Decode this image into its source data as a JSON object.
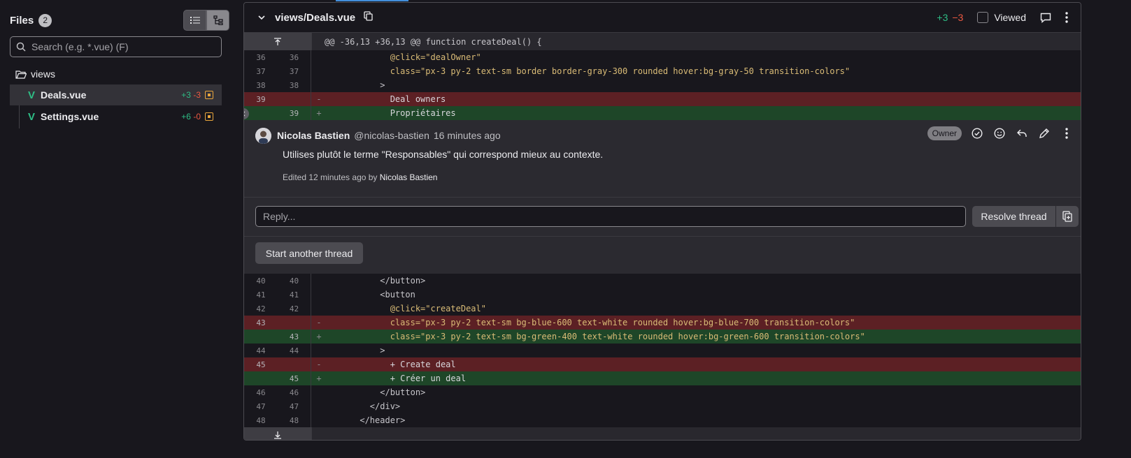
{
  "sidebar": {
    "title": "Files",
    "count": "2",
    "search": {
      "placeholder": "Search (e.g. *.vue) (F)"
    },
    "folder": "views",
    "files": [
      {
        "name": "Deals.vue",
        "added": "+3",
        "removed": "-3"
      },
      {
        "name": "Settings.vue",
        "added": "+6",
        "removed": "-0"
      }
    ]
  },
  "diff": {
    "file_path": "views/Deals.vue",
    "added": "+3",
    "removed": "−3",
    "viewed_label": "Viewed",
    "hunk_header": "@@ -36,13 +36,13 @@ function createDeal() {",
    "lines_top": [
      {
        "old": "36",
        "new": "36",
        "text": "            @click=\"dealOwner\""
      },
      {
        "old": "37",
        "new": "37",
        "text": "            class=\"px-3 py-2 text-sm border border-gray-300 rounded hover:bg-gray-50 transition-colors\""
      },
      {
        "old": "38",
        "new": "38",
        "text": "          >"
      },
      {
        "old": "39",
        "new": "",
        "sign": "-",
        "text": "            Deal owners"
      },
      {
        "old": "",
        "new": "39",
        "sign": "+",
        "text": "            Propriétaires"
      }
    ],
    "lines_bottom": [
      {
        "old": "40",
        "new": "40",
        "text": "          </button>"
      },
      {
        "old": "41",
        "new": "41",
        "text": "          <button"
      },
      {
        "old": "42",
        "new": "42",
        "text": "            @click=\"createDeal\""
      },
      {
        "old": "43",
        "new": "",
        "sign": "-",
        "text": "            class=\"px-3 py-2 text-sm bg-blue-600 text-white rounded hover:bg-blue-700 transition-colors\""
      },
      {
        "old": "",
        "new": "43",
        "sign": "+",
        "text": "            class=\"px-3 py-2 text-sm bg-green-400 text-white rounded hover:bg-green-600 transition-colors\""
      },
      {
        "old": "44",
        "new": "44",
        "text": "          >"
      },
      {
        "old": "45",
        "new": "",
        "sign": "-",
        "text": "            + Create deal"
      },
      {
        "old": "",
        "new": "45",
        "sign": "+",
        "text": "            + Créer un deal"
      },
      {
        "old": "46",
        "new": "46",
        "text": "          </button>"
      },
      {
        "old": "47",
        "new": "47",
        "text": "        </div>"
      },
      {
        "old": "48",
        "new": "48",
        "text": "      </header>"
      }
    ]
  },
  "discussion": {
    "author": "Nicolas Bastien",
    "handle": "@nicolas-bastien",
    "time": "16 minutes ago",
    "role_badge": "Owner",
    "body": "Utilises plutôt le terme \"Responsables\" qui correspond mieux au contexte.",
    "edited_prefix": "Edited 12 minutes ago by",
    "edited_by": "Nicolas Bastien",
    "reply_placeholder": "Reply...",
    "resolve_label": "Resolve thread",
    "start_thread_label": "Start another thread"
  },
  "colors": {
    "added": "#2ebd85",
    "removed": "#ec5941",
    "modified_icon": "#e9a63c",
    "link_accent": "#428fdc"
  }
}
